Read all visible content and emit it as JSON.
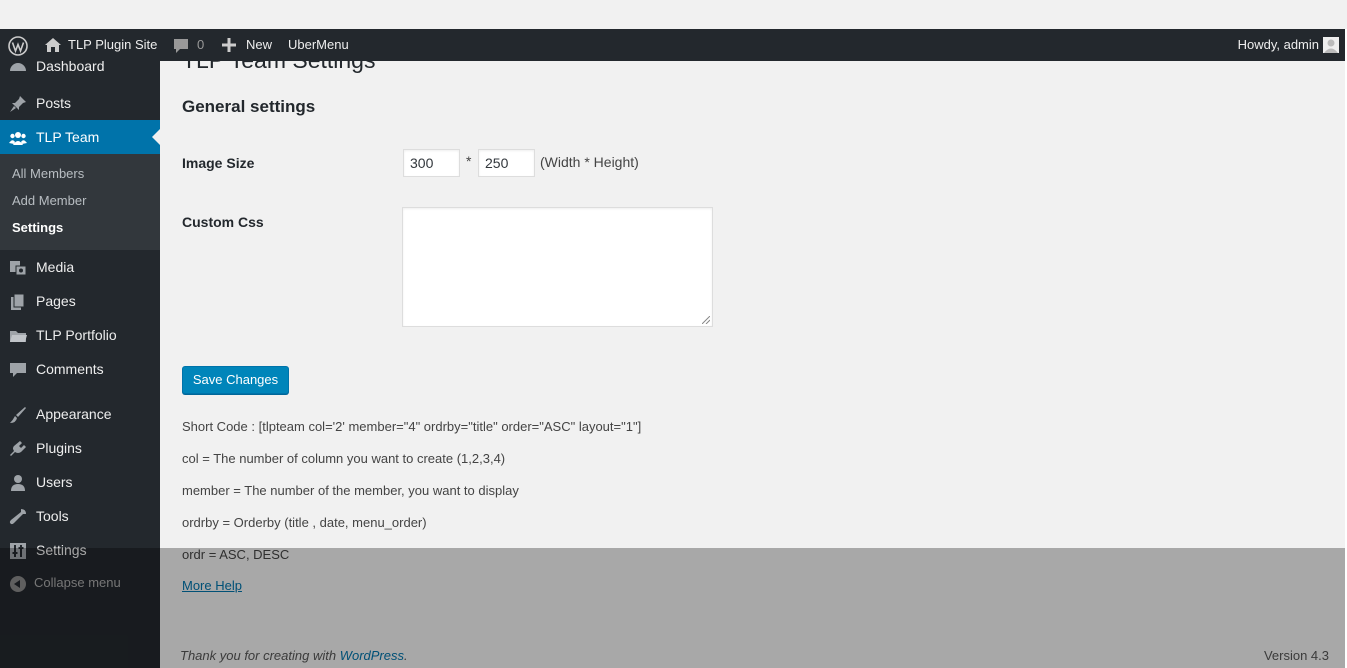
{
  "adminbar": {
    "site_name": "TLP Plugin Site",
    "comments_count": "0",
    "new_label": "New",
    "ubermenu_label": "UberMenu",
    "howdy_label": "Howdy, admin"
  },
  "sidebar": {
    "dashboard_label": "Dashboard",
    "items": [
      {
        "label": "Posts",
        "icon": "pin-icon"
      },
      {
        "label": "TLP Team",
        "icon": "team-icon"
      },
      {
        "label": "Media",
        "icon": "media-icon"
      },
      {
        "label": "Pages",
        "icon": "pages-icon"
      },
      {
        "label": "TLP Portfolio",
        "icon": "folder-icon"
      },
      {
        "label": "Comments",
        "icon": "comment-icon"
      },
      {
        "label": "Appearance",
        "icon": "brush-icon"
      },
      {
        "label": "Plugins",
        "icon": "plugin-icon"
      },
      {
        "label": "Users",
        "icon": "user-icon"
      },
      {
        "label": "Tools",
        "icon": "wrench-icon"
      },
      {
        "label": "Settings",
        "icon": "sliders-icon"
      }
    ],
    "submenu": [
      "All Members",
      "Add Member",
      "Settings"
    ],
    "collapse_label": "Collapse menu"
  },
  "main": {
    "page_title": "TLP Team Settings",
    "section_title": "General settings",
    "image_size_label": "Image Size",
    "width_value": "300",
    "height_value": "250",
    "times_symbol": "*",
    "dims_hint": "(Width * Height)",
    "custom_css_label": "Custom Css",
    "custom_css_value": "",
    "save_label": "Save Changes",
    "help_lines": [
      "Short Code : [tlpteam col='2' member=\"4\" ordrby=\"title\" order=\"ASC\" layout=\"1\"]",
      "col = The number of column you want to create (1,2,3,4)",
      "member = The number of the member, you want to display",
      "ordrby = Orderby (title , date, menu_order)",
      "ordr = ASC, DESC"
    ],
    "more_help_label": "More Help"
  },
  "footer": {
    "thanks_text": "Thank you for creating with ",
    "wordpress_link": "WordPress",
    "thanks_end": ".",
    "version": "Version 4.3"
  },
  "colors": {
    "adminbar_bg": "#23282d",
    "accent": "#0073aa",
    "button": "#0085ba"
  }
}
